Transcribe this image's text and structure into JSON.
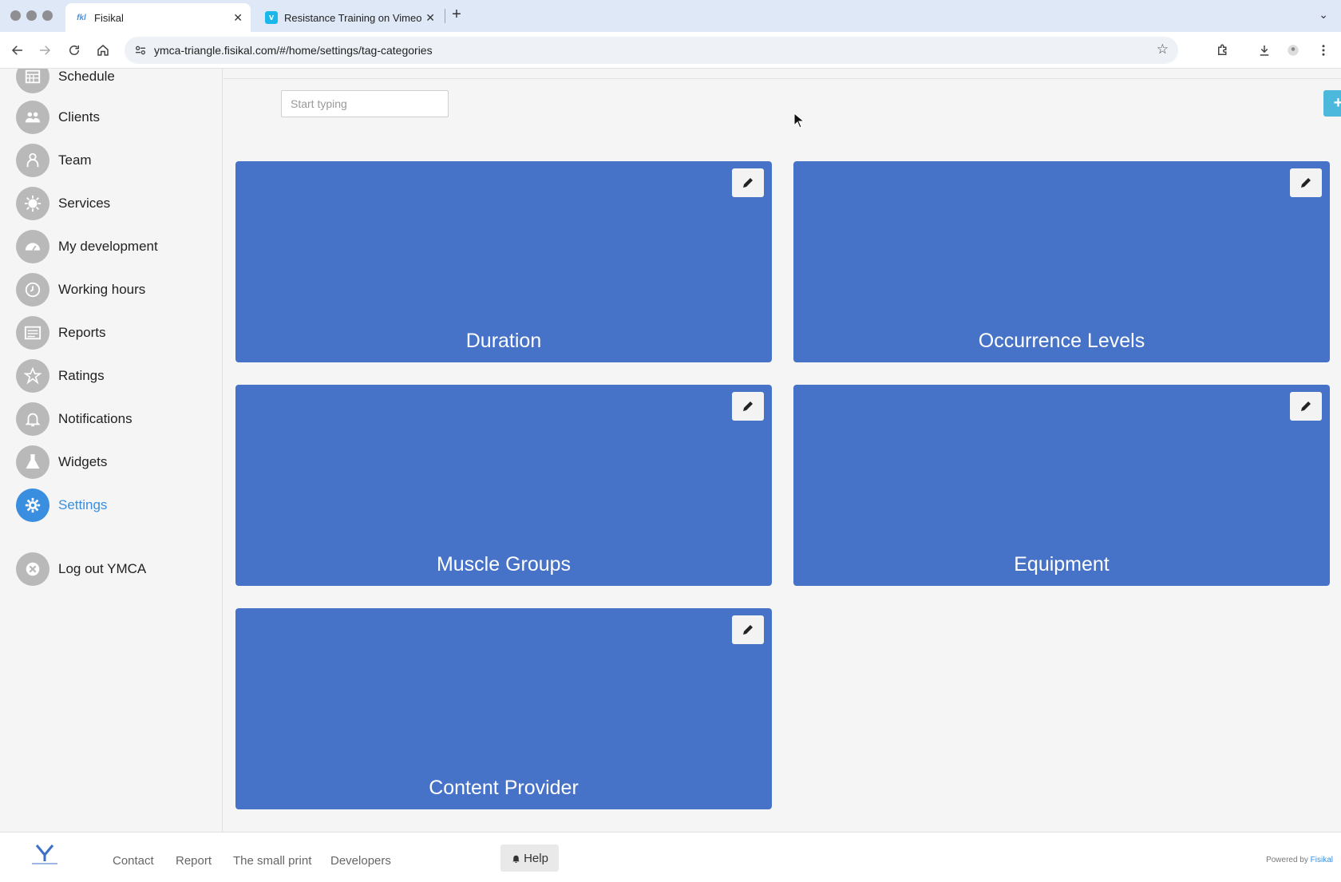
{
  "browser": {
    "tabs": [
      {
        "title": "Fisikal",
        "favicon": "fisikal-icon",
        "active": true
      },
      {
        "title": "Resistance Training on Vimeo",
        "favicon": "vimeo-icon",
        "active": false
      }
    ],
    "url": "ymca-triangle.fisikal.com/#/home/settings/tag-categories"
  },
  "sidebar": {
    "items": [
      {
        "label": "Schedule",
        "icon": "calendar-icon"
      },
      {
        "label": "Clients",
        "icon": "people-icon"
      },
      {
        "label": "Team",
        "icon": "team-icon"
      },
      {
        "label": "Services",
        "icon": "sun-icon"
      },
      {
        "label": "My development",
        "icon": "dashboard-icon"
      },
      {
        "label": "Working hours",
        "icon": "clock-icon"
      },
      {
        "label": "Reports",
        "icon": "list-icon"
      },
      {
        "label": "Ratings",
        "icon": "star-icon"
      },
      {
        "label": "Notifications",
        "icon": "bell-icon"
      },
      {
        "label": "Widgets",
        "icon": "flask-icon"
      },
      {
        "label": "Settings",
        "icon": "gear-icon",
        "active": true
      },
      {
        "label": "Log out YMCA",
        "icon": "close-circle-icon"
      }
    ]
  },
  "main": {
    "search_placeholder": "Start typing",
    "add_label": "+",
    "categories": [
      {
        "title": "Duration"
      },
      {
        "title": "Occurrence Levels"
      },
      {
        "title": "Muscle Groups"
      },
      {
        "title": "Equipment"
      },
      {
        "title": "Content Provider"
      }
    ]
  },
  "footer": {
    "links": [
      "Contact",
      "Report",
      "The small print",
      "Developers"
    ],
    "help_label": "Help",
    "powered_by": "Powered by",
    "powered_brand": "Fisikal"
  },
  "colors": {
    "card_bg": "#4673c8",
    "accent": "#3a8ee0",
    "add_button": "#4cb8dc"
  }
}
